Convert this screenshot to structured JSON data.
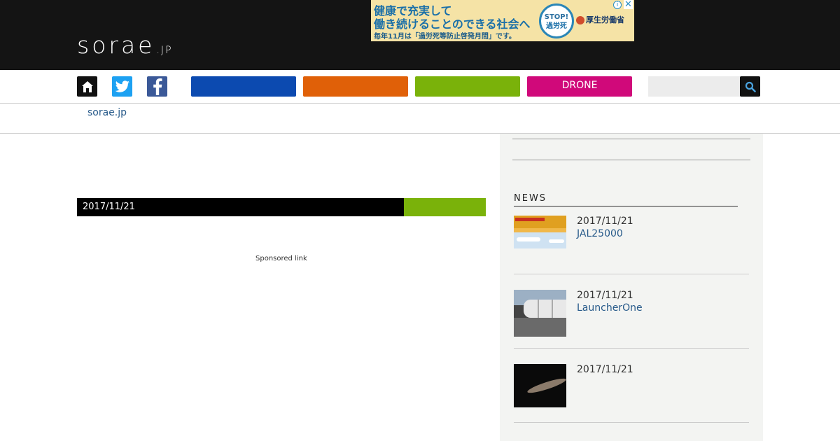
{
  "header": {
    "logo": {
      "main": "sorae",
      "suffix": ".JP"
    },
    "ad": {
      "line1": "健康で充実して",
      "line2": "働き続けることのできる社会へ",
      "line3": "毎年11月は「過労死等防止啓発月間」です。",
      "badge_top": "STOP!",
      "badge_bottom": "過労死",
      "ministry": "厚生労働省"
    }
  },
  "nav": {
    "categories": [
      {
        "label": "",
        "color": "#0c4ab0"
      },
      {
        "label": "",
        "color": "#e06008"
      },
      {
        "label": "",
        "color": "#7ab20a"
      },
      {
        "label": "DRONE",
        "color": "#d0097a"
      }
    ],
    "search": {
      "value": "",
      "placeholder": ""
    }
  },
  "breadcrumb": {
    "home": "sorae.jp"
  },
  "article": {
    "date": "2017/11/21",
    "sponsored": "Sponsored link"
  },
  "sidebar": {
    "news_heading": "NEWS",
    "news": [
      {
        "date": "2017/11/21",
        "title": "JAL25000"
      },
      {
        "date": "2017/11/21",
        "title": "LauncherOne"
      },
      {
        "date": "2017/11/21",
        "title": ""
      }
    ]
  },
  "icons": {
    "home": "home-icon",
    "twitter": "twitter-icon",
    "facebook": "facebook-icon",
    "search": "search-icon"
  }
}
